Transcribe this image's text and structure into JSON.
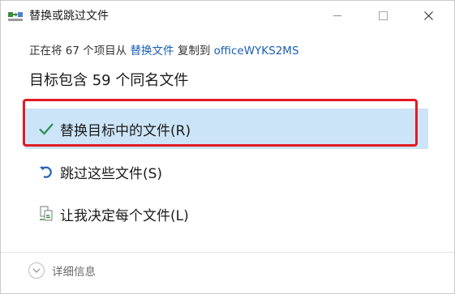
{
  "window": {
    "title": "替换或跳过文件"
  },
  "content": {
    "subtitle_prefix": "正在将 67 个项目从 ",
    "source_name": "替换文件",
    "subtitle_middle": " 复制到 ",
    "dest_name": "officeWYKS2MS",
    "heading": "目标包含 59 个同名文件"
  },
  "options": [
    {
      "label": "替换目标中的文件(R)",
      "icon": "checkmark-icon",
      "selected": true
    },
    {
      "label": "跳过这些文件(S)",
      "icon": "undo-arrow-icon",
      "selected": false
    },
    {
      "label": "让我决定每个文件(L)",
      "icon": "compare-files-icon",
      "selected": false
    }
  ],
  "footer": {
    "details_label": "详细信息"
  },
  "colors": {
    "selected_bg": "#cce4f7",
    "highlight_border": "#e01b24",
    "link": "#1a5fb4",
    "checkmark": "#2e8b57"
  }
}
